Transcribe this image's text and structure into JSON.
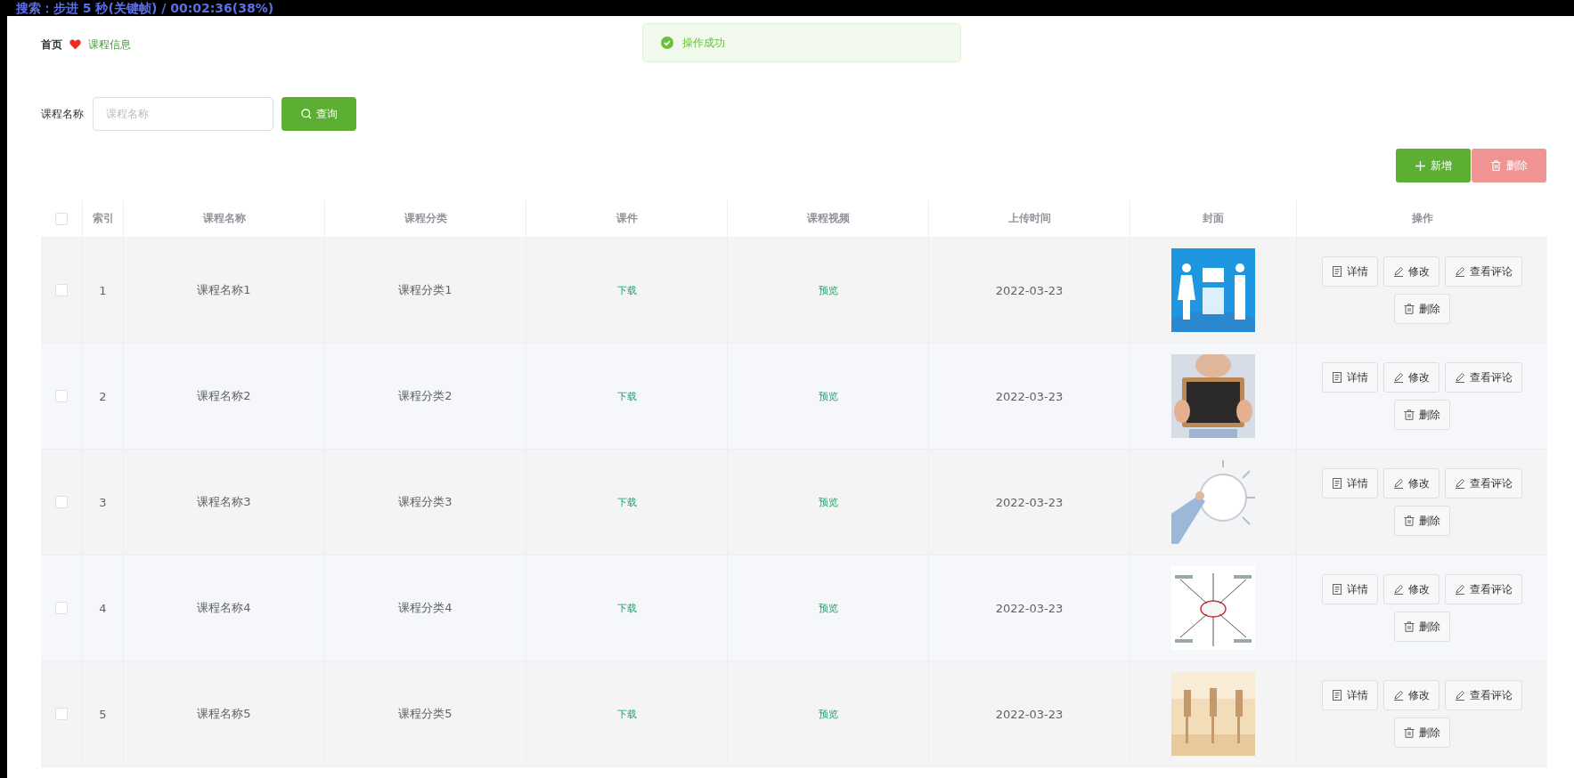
{
  "osd_text": "搜索：步进 5 秒(关键帧) / 00:02:36(38%)",
  "breadcrumb": [
    {
      "label": "首页",
      "current": false
    },
    {
      "label": "课程信息",
      "current": true
    }
  ],
  "toast": {
    "kind": "success",
    "message": "操作成功"
  },
  "search": {
    "label": "课程名称",
    "placeholder": "课程名称",
    "button": "查询"
  },
  "toolbar": [
    {
      "label": "新增",
      "kind": "add",
      "disabled": false
    },
    {
      "label": "删除",
      "kind": "delete",
      "disabled": true
    }
  ],
  "table": {
    "all_checked": false,
    "columns": [
      "索引",
      "课程名称",
      "课程分类",
      "课件",
      "课程视频",
      "上传时间",
      "封面",
      "操作"
    ],
    "rows": [
      {
        "checked": false,
        "index": "1",
        "name": "课程名称1",
        "category": "课程分类1",
        "courseware": "下载",
        "video": "预览",
        "upload_time": "2022-03-23",
        "cover": {
          "kind": "picture"
        },
        "actions": [
          {
            "label": "详情",
            "kind": "detail"
          },
          {
            "label": "修改",
            "kind": "edit"
          },
          {
            "label": "查看评论",
            "kind": "edit"
          },
          {
            "label": "删除",
            "kind": "delete"
          }
        ]
      },
      {
        "checked": false,
        "index": "2",
        "name": "课程名称2",
        "category": "课程分类2",
        "courseware": "下载",
        "video": "预览",
        "upload_time": "2022-03-23",
        "cover": {
          "kind": "picture"
        },
        "actions": [
          {
            "label": "详情",
            "kind": "detail"
          },
          {
            "label": "修改",
            "kind": "edit"
          },
          {
            "label": "查看评论",
            "kind": "edit"
          },
          {
            "label": "删除",
            "kind": "delete"
          }
        ]
      },
      {
        "checked": false,
        "index": "3",
        "name": "课程名称3",
        "category": "课程分类3",
        "courseware": "下载",
        "video": "预览",
        "upload_time": "2022-03-23",
        "cover": {
          "kind": "picture"
        },
        "actions": [
          {
            "label": "详情",
            "kind": "detail"
          },
          {
            "label": "修改",
            "kind": "edit"
          },
          {
            "label": "查看评论",
            "kind": "edit"
          },
          {
            "label": "删除",
            "kind": "delete"
          }
        ]
      },
      {
        "checked": false,
        "index": "4",
        "name": "课程名称4",
        "category": "课程分类4",
        "courseware": "下载",
        "video": "预览",
        "upload_time": "2022-03-23",
        "cover": {
          "kind": "picture"
        },
        "actions": [
          {
            "label": "详情",
            "kind": "detail"
          },
          {
            "label": "修改",
            "kind": "edit"
          },
          {
            "label": "查看评论",
            "kind": "edit"
          },
          {
            "label": "删除",
            "kind": "delete"
          }
        ]
      },
      {
        "checked": false,
        "index": "5",
        "name": "课程名称5",
        "category": "课程分类5",
        "courseware": "下载",
        "video": "预览",
        "upload_time": "2022-03-23",
        "cover": {
          "kind": "picture"
        },
        "actions": [
          {
            "label": "详情",
            "kind": "detail"
          },
          {
            "label": "修改",
            "kind": "edit"
          },
          {
            "label": "查看评论",
            "kind": "edit"
          },
          {
            "label": "删除",
            "kind": "delete"
          }
        ]
      }
    ]
  }
}
